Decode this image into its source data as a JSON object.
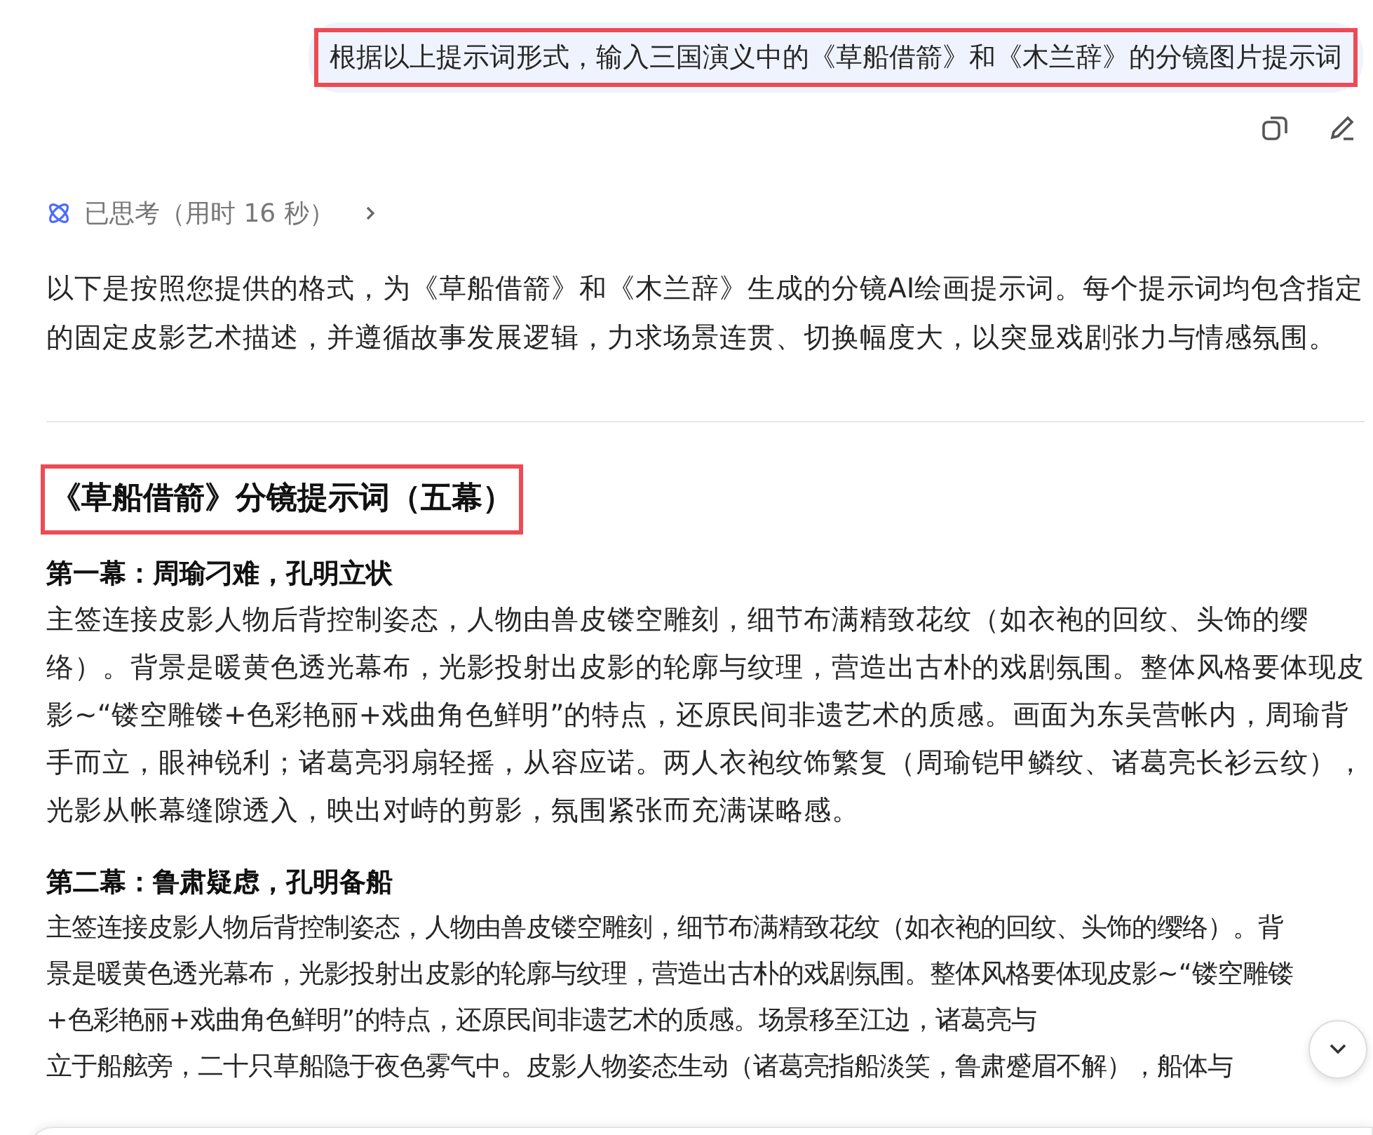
{
  "user_message": {
    "text": "根据以上提示词形式，输入三国演义中的《草船借箭》和《木兰辞》的分镜图片提示词"
  },
  "thinking": {
    "label": "已思考（用时 16 秒）",
    "expanded": false
  },
  "intro": "以下是按照您提供的格式，为《草船借箭》和《木兰辞》生成的分镜AI绘画提示词。每个提示词均包含指定的固定皮影艺术描述，并遵循故事发展逻辑，力求场景连贯、切换幅度大，以突显戏剧张力与情感氛围。",
  "section": {
    "title": "《草船借箭》分镜提示词（五幕）",
    "scenes": [
      {
        "title": "第一幕：周瑜刁难，孔明立状",
        "body": [
          "主签连接皮影人物后背控制姿态，人物由兽皮镂空雕刻，细节布满精致花纹（如衣袍的回纹、头饰的缨络）。背景是暖黄色透光幕布，光影投射出皮影的轮廓与纹理，营造出古朴的戏剧氛围。整体风格要体现皮影~“镂空雕镂+色彩艳丽+戏曲角色鲜明”的特点，还原民间非遗艺术的质感。画面为东吴营帐内，周瑜背手而立，眼神锐利；诸葛亮羽扇轻摇，从容应诺。两人衣袍纹饰繁复（周瑜铠甲鳞纹、诸葛亮长衫云纹），光影从帐幕缝隙透入，映出对峙的剪影，氛围紧张而充满谋略感。"
        ]
      },
      {
        "title": "第二幕：鲁肃疑虑，孔明备船",
        "body": [
          "主签连接皮影人物后背控制姿态，人物由兽皮镂空雕刻，细节布满精致花纹（如衣袍的回纹、头饰的缨络）。背景是暖黄色透光幕布，光影投射出皮影的轮廓与纹理，营造出古朴的戏剧氛围。整体风格要体现皮影~“镂空雕镂+色彩艳丽+戏曲角色鲜明”的特点，还原民间非遗艺术的质感。场景移至江边，诸葛亮与",
          "立于船舷旁，二十只草船隐于夜色雾气中。皮影人物姿态生动（诸葛亮指船淡笑，鲁肃蹙眉不解），船体与"
        ]
      }
    ]
  }
}
